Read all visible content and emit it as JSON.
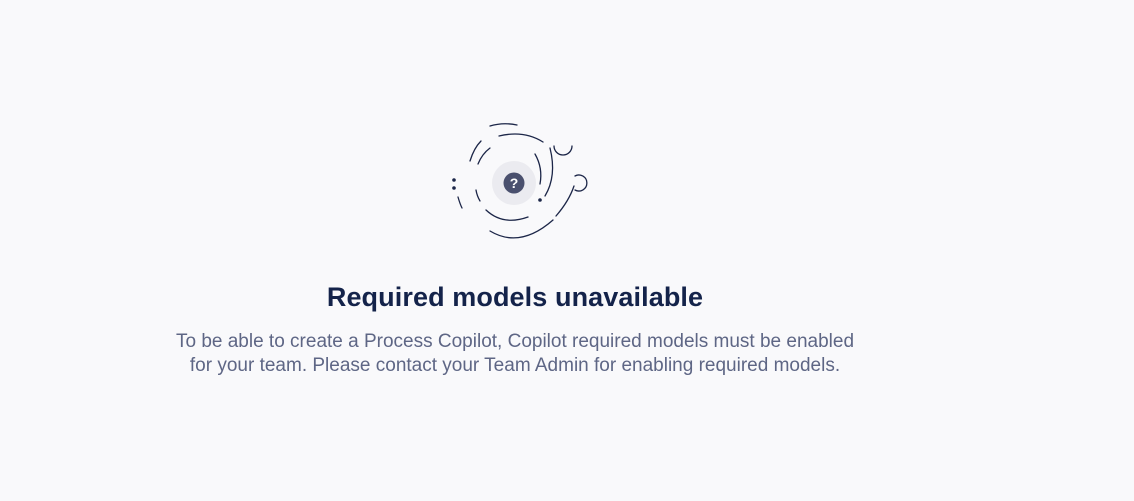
{
  "empty_state": {
    "icon": "question-mark-icon",
    "icon_glyph": "?",
    "title": "Required models unavailable",
    "description_lines": [
      "To be able to create a Process Copilot, Copilot required models must be enabled",
      "for your team. Please contact your Team Admin for enabling required models."
    ]
  },
  "colors": {
    "background": "#f9f9fb",
    "title": "#14234a",
    "description": "#5e6685",
    "illustration_line": "#1c2648",
    "icon_badge": "#4a506e",
    "icon_halo": "#ebebf0"
  }
}
